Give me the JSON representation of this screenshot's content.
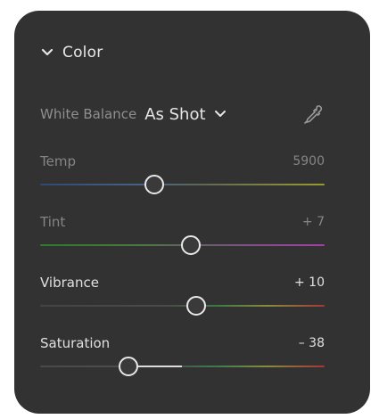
{
  "section": {
    "title": "Color",
    "expanded_icon": "chevron-down-icon"
  },
  "white_balance": {
    "label": "White Balance",
    "value": "As Shot",
    "dropdown_icon": "chevron-down-icon",
    "tool_icon": "eyedropper-icon"
  },
  "sliders": [
    {
      "label": "Temp",
      "value": "5900",
      "level": 0.4,
      "enabled": false
    },
    {
      "label": "Tint",
      "value": "+ 7",
      "level": 0.53,
      "enabled": false
    },
    {
      "label": "Vibrance",
      "value": "+ 10",
      "level": 0.55,
      "enabled": true
    },
    {
      "label": "Saturation",
      "value": "– 38",
      "level": 0.31,
      "enabled": true
    }
  ],
  "colors": {
    "panel_bg": "#323232",
    "text_primary": "#e6e6e6",
    "text_dim": "#858585",
    "knob_border": "#e8e8e8"
  }
}
